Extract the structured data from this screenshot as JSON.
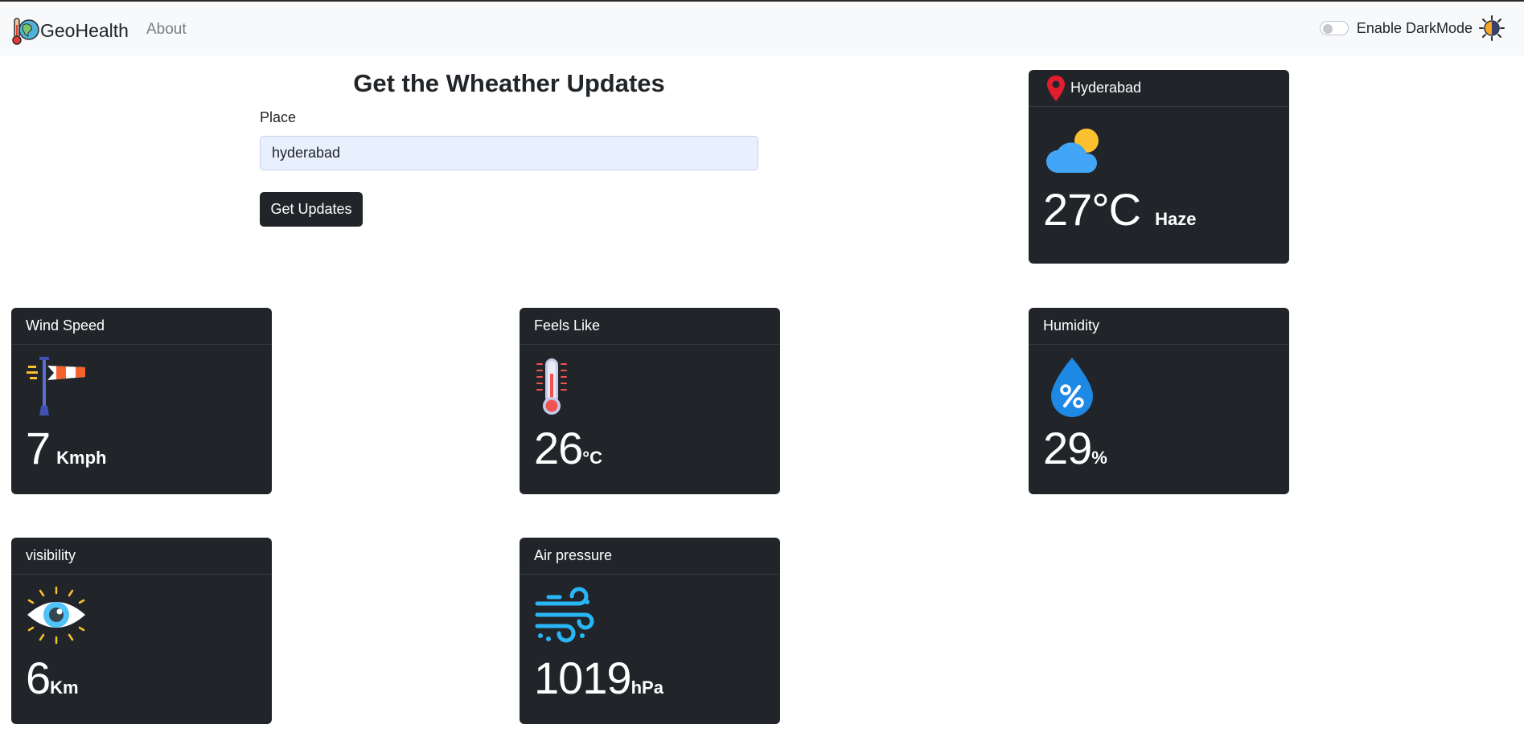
{
  "navbar": {
    "brand": "GeoHealth",
    "about": "About",
    "darkmode_label": "Enable DarkMode"
  },
  "form": {
    "title": "Get the Wheather Updates",
    "place_label": "Place",
    "place_value": "hyderabad",
    "button_label": "Get Updates"
  },
  "current": {
    "location": "Hyderabad",
    "temperature": "27°C",
    "condition": "Haze",
    "icon": "partly-cloudy-icon"
  },
  "cards": {
    "wind": {
      "title": "Wind Speed",
      "value": "7",
      "unit": "Kmph",
      "icon": "windsock-icon"
    },
    "feels": {
      "title": "Feels Like",
      "value": "26",
      "unit": "°C",
      "icon": "thermometer-icon"
    },
    "humidity": {
      "title": "Humidity",
      "value": "29",
      "unit": "%",
      "icon": "humidity-drop-icon"
    },
    "visibility": {
      "title": "visibility",
      "value": "6",
      "unit": "Km",
      "icon": "eye-icon"
    },
    "pressure": {
      "title": "Air pressure",
      "value": "1019",
      "unit": "hPa",
      "icon": "wind-gust-icon"
    }
  },
  "colors": {
    "card_bg": "#212529",
    "navbar_bg": "#f8f9fa",
    "input_bg": "#e8f0fe",
    "pin_red": "#e11d2e",
    "cloud_blue": "#42a5f5",
    "sun_yellow": "#fbc02d"
  }
}
